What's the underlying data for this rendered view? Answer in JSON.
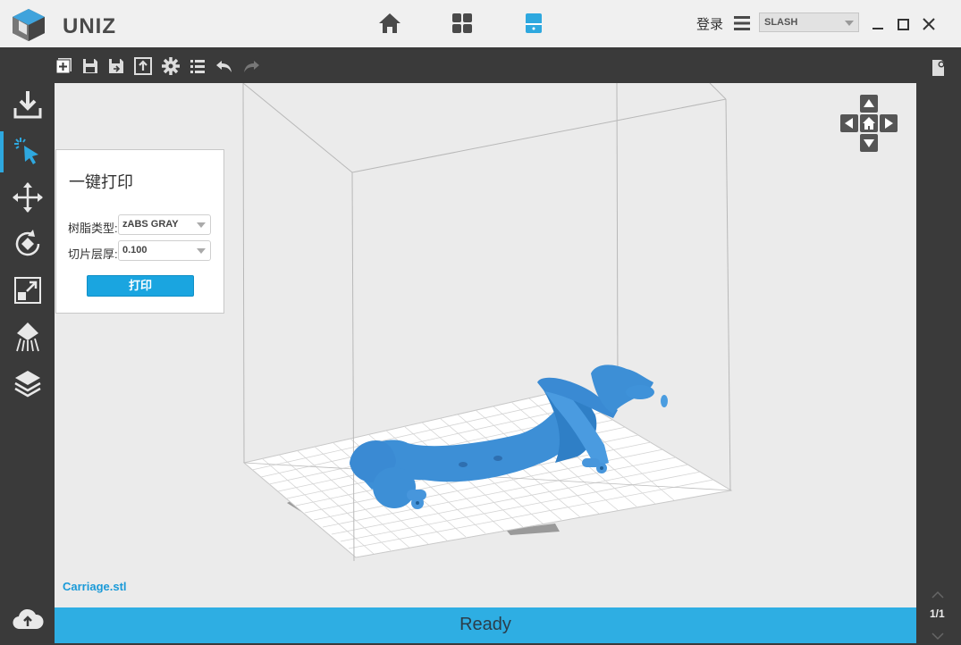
{
  "app": {
    "brand": "UNIZ"
  },
  "header": {
    "login_label": "登录",
    "device_select": "SLASH"
  },
  "panel": {
    "title": "一键打印",
    "resin_label": "树脂类型:",
    "resin_value": "zABS GRAY",
    "layer_label": "切片层厚:",
    "layer_value": "0.100",
    "print_button": "打印"
  },
  "viewport": {
    "filename": "Carriage.stl"
  },
  "status": {
    "text": "Ready",
    "page": "1/1"
  },
  "colors": {
    "accent": "#2eaee3",
    "model": "#3d8fd6",
    "sidebar": "#3a3a3a"
  }
}
